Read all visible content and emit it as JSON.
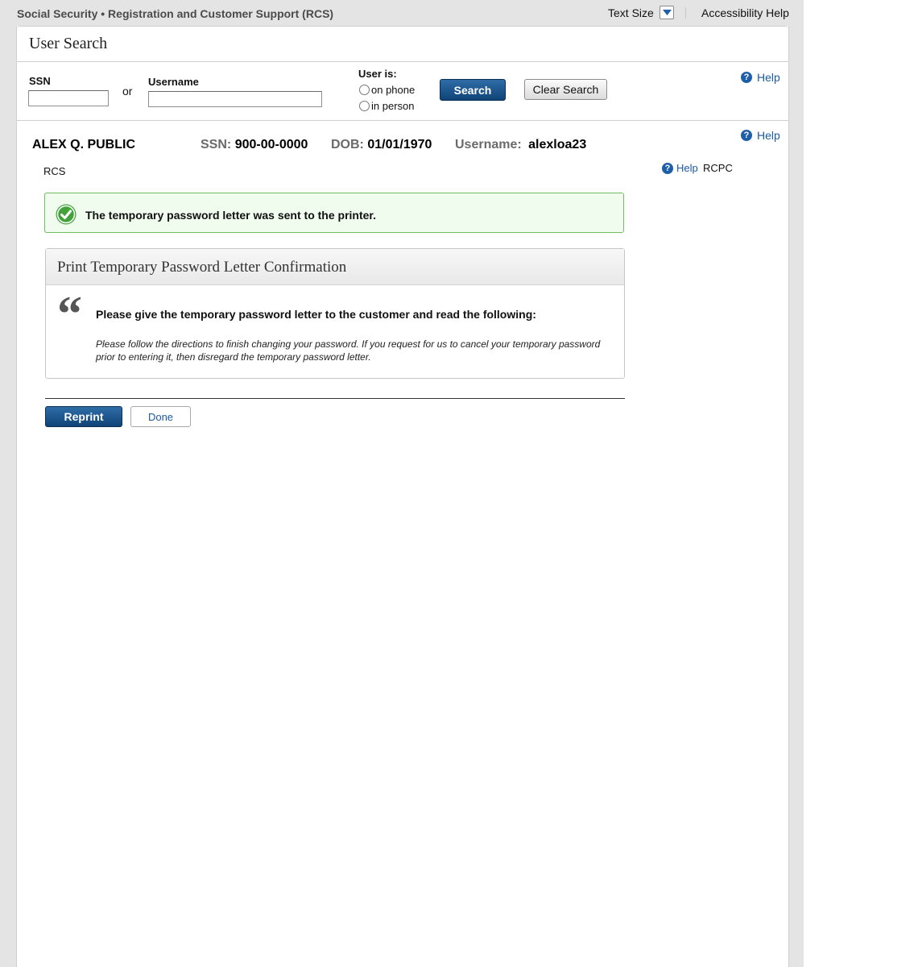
{
  "app": {
    "title": "Social Security • Registration and Customer Support (RCS)",
    "text_size_label": "Text Size",
    "accessibility_help": "Accessibility Help"
  },
  "user_search": {
    "title": "User Search",
    "ssn_label": "SSN",
    "ssn_value": "",
    "or_label": "or",
    "username_label": "Username",
    "username_value": "",
    "user_is_label": "User is:",
    "options": [
      "on phone",
      "in person"
    ],
    "search_button": "Search",
    "clear_button": "Clear Search",
    "help": "Help"
  },
  "customer": {
    "name": "ALEX Q. PUBLIC",
    "ssn_label": "SSN:",
    "ssn": "900-00-0000",
    "dob_label": "DOB:",
    "dob": "01/01/1970",
    "username_label": "Username:",
    "username": "alexloa23",
    "help": "Help",
    "rcs": "RCS",
    "rcpc_help": "Help",
    "rcpc": "RCPC"
  },
  "success": {
    "message": "The temporary password letter was sent to the printer."
  },
  "confirmation": {
    "title": "Print Temporary Password Letter Confirmation",
    "lead": "Please give the temporary password letter to the customer and read the following:",
    "script": "Please follow the directions to finish changing your password. If you request for us to cancel your temporary password prior to entering it, then disregard the temporary password letter."
  },
  "actions": {
    "reprint": "Reprint",
    "done": "Done"
  },
  "icons": {
    "help": "help-icon",
    "success": "check-circle-icon",
    "quote": "quote-icon",
    "dropdown": "chevron-down-icon"
  },
  "colors": {
    "primary_button": "#0f4477",
    "link": "#1a5aa5",
    "success_border": "#6fbf62",
    "success_bg": "#f0fcee"
  }
}
